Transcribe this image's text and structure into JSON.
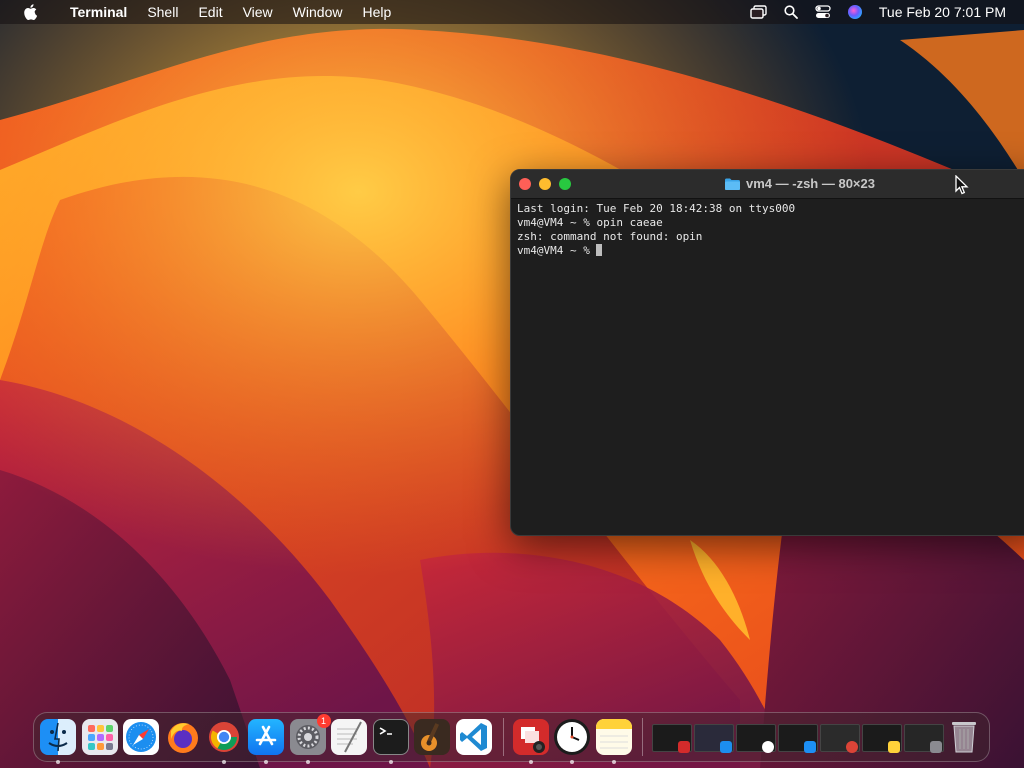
{
  "menubar": {
    "app_name": "Terminal",
    "menus": [
      "Shell",
      "Edit",
      "View",
      "Window",
      "Help"
    ],
    "clock": "Tue Feb 20  7:01 PM",
    "status_icons": [
      "screen-mirroring-icon",
      "spotlight-search-icon",
      "control-center-icon",
      "siri-icon"
    ]
  },
  "terminal": {
    "title": "vm4 — -zsh — 80×23",
    "lines": [
      "Last login: Tue Feb 20 18:42:38 on ttys000",
      "vm4@VM4 ~ % opin caeae",
      "zsh: command not found: opin",
      "vm4@VM4 ~ % "
    ]
  },
  "dock": {
    "apps": [
      {
        "name": "Finder",
        "icon": "finder-icon",
        "running": true
      },
      {
        "name": "Launchpad",
        "icon": "launchpad-icon",
        "running": false
      },
      {
        "name": "Safari",
        "icon": "safari-icon",
        "running": false
      },
      {
        "name": "Firefox",
        "icon": "firefox-icon",
        "running": false
      },
      {
        "name": "Google Chrome",
        "icon": "chrome-icon",
        "running": true
      },
      {
        "name": "App Store",
        "icon": "app-store-icon",
        "running": true
      },
      {
        "name": "System Settings",
        "icon": "system-settings-icon",
        "running": true,
        "badge": "1"
      },
      {
        "name": "TextEdit",
        "icon": "textedit-icon",
        "running": false
      },
      {
        "name": "Terminal",
        "icon": "terminal-icon",
        "running": true
      },
      {
        "name": "GarageBand",
        "icon": "garageband-icon",
        "running": false
      },
      {
        "name": "Visual Studio Code",
        "icon": "vscode-icon",
        "running": false
      }
    ],
    "recent_apps": [
      {
        "name": "Photo Booth",
        "icon": "photo-booth-icon",
        "running": true
      },
      {
        "name": "Clock",
        "icon": "clock-icon",
        "running": true
      },
      {
        "name": "Notes",
        "icon": "notes-icon",
        "running": true
      }
    ],
    "minimized_windows": [
      {
        "icon": "photo-booth-icon"
      },
      {
        "icon": "app-store-icon"
      },
      {
        "icon": "clock-icon"
      },
      {
        "icon": "finder-icon"
      },
      {
        "icon": "chrome-icon"
      },
      {
        "icon": "notes-icon"
      },
      {
        "icon": "system-settings-icon"
      }
    ],
    "trash_icon": "trash-icon"
  },
  "colors": {
    "terminal_bg": "#1e1e1e",
    "close": "#fe5f57",
    "minimize": "#febc2e",
    "maximize": "#28c840",
    "badge": "#ff3b30"
  }
}
